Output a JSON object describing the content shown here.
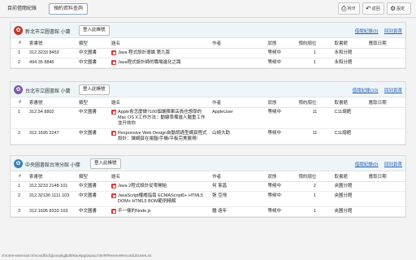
{
  "tabs": [
    {
      "label": "目前借閱紀錄",
      "active": false
    },
    {
      "label": "預約資料查詢",
      "active": true
    }
  ],
  "toolbar": {
    "print_label": "列印",
    "back_label": "返回",
    "settings_label": "設定"
  },
  "columns": [
    "#",
    "索書號",
    "類型",
    "題名",
    "作者",
    "狀態",
    "預約順位",
    "取書館",
    "應取日期"
  ],
  "panels": [
    {
      "library_user": "新北市立圖書館 小蘭",
      "logo_color": "#c0392b",
      "login_label": "登入此帳號",
      "history_link": "借閱紀錄(3)",
      "top_link": "回到頁首",
      "rows": [
        {
          "n": "1",
          "call": "312.3233 8453",
          "type": "中文圖書",
          "title": "Java 程式設計導論 第九版",
          "author": "",
          "status": "等候中",
          "order": "1",
          "pickup": "永和分館",
          "due": ""
        },
        {
          "n": "2",
          "call": "494.35 8846",
          "type": "中文圖書",
          "title": "Java程式設計師的職場進化之路",
          "author": "",
          "status": "等候中",
          "order": "1",
          "pickup": "永和分館",
          "due": ""
        }
      ]
    },
    {
      "library_user": "台北市立圖書館 小蘭",
      "logo_color": "#7d5ba6",
      "login_label": "登入此帳號",
      "history_link": "借閱紀錄(10)",
      "top_link": "回到頁首",
      "rows": [
        {
          "n": "1",
          "call": "312.54 8802",
          "type": "中文圖書",
          "title": "Apple會怎麼做?100個讓蘋果店員也想學的Mac OS X工作方法：動線準備進人腦重工作並升效你",
          "author": "AppleUser",
          "status": "等候中",
          "order": "11",
          "pickup": "C11總館",
          "due": ""
        },
        {
          "n": "2",
          "call": "312.1695 2247",
          "type": "中文圖書",
          "title": "Responsive Web Design自動調適型網頁程式設計：讓網頁在電腦/手機/平板完美展現!",
          "author": "山崎大助",
          "status": "等候中",
          "order": "11",
          "pickup": "C11總館",
          "due": ""
        }
      ]
    },
    {
      "library_user": "中央圖書館台灣分館 小櫻",
      "logo_color": "#3d7fb8",
      "login_label": "登入此帳號",
      "history_link": "借閱紀錄(0)",
      "top_link": "回到頁首",
      "rows": [
        {
          "n": "1",
          "call": "312.3233 2148 101",
          "type": "中文圖書",
          "title": "Java 2程式設計從零開始",
          "author": "何 憲昌",
          "status": "等候中",
          "order": "2",
          "pickup": "央圖分館",
          "due": ""
        },
        {
          "n": "2",
          "call": "312.32136 1111 103",
          "type": "中文圖書",
          "title": "JavaScript權威指南 ECMAScript5+ HTML5 DOM+ HTML5 BOM範例精解",
          "author": "張 亞飛",
          "status": "等候中",
          "order": "1",
          "pickup": "央圖分館",
          "due": ""
        },
        {
          "n": "3",
          "call": "312.1695 8333 103",
          "type": "中文圖書",
          "title": "不一樣的Node.js",
          "author": "鍾 遠年",
          "status": "等候中",
          "order": "1",
          "pickup": "央圖分館",
          "due": ""
        }
      ]
    }
  ],
  "statusbar": "chrome-extension://ncoodfcidcjjoonpkgjbdkhkaokpg/popup.html#/ReserveRecordLibUserList"
}
